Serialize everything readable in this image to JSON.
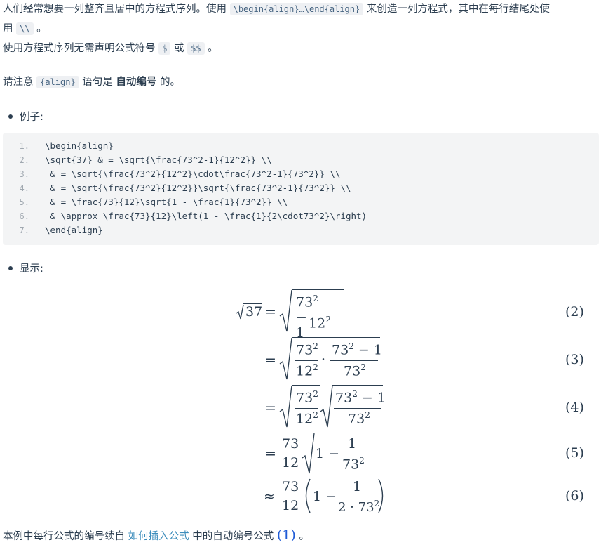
{
  "intro": {
    "p1_a": "人们经常想要一列整齐且居中的方程式序列。使用",
    "p1_code": "\\begin{align}…\\end{align}",
    "p1_b": "来创造一列方程式，其中在每行结尾处使",
    "p1_c": "用",
    "p1_code2": "\\\\",
    "p1_d": "。",
    "p2_a": "使用方程式序列无需声明公式符号",
    "p2_code1": "$",
    "p2_b": "或",
    "p2_code2": "$$",
    "p2_c": "。",
    "p3_a": "请注意",
    "p3_code": "{align}",
    "p3_b": "语句是",
    "p3_strong": "自动编号",
    "p3_c": "的。"
  },
  "example_label": "例子:",
  "code_lines": [
    {
      "n": "1.",
      "t": "\\begin{align}"
    },
    {
      "n": "2.",
      "t": "\\sqrt{37} & = \\sqrt{\\frac{73^2-1}{12^2}} \\\\"
    },
    {
      "n": "3.",
      "t": " & = \\sqrt{\\frac{73^2}{12^2}\\cdot\\frac{73^2-1}{73^2}} \\\\"
    },
    {
      "n": "4.",
      "t": " & = \\sqrt{\\frac{73^2}{12^2}}\\sqrt{\\frac{73^2-1}{73^2}} \\\\"
    },
    {
      "n": "5.",
      "t": " & = \\frac{73}{12}\\sqrt{1 - \\frac{1}{73^2}} \\\\"
    },
    {
      "n": "6.",
      "t": " & \\approx \\frac{73}{12}\\left(1 - \\frac{1}{2\\cdot73^2}\\right)"
    },
    {
      "n": "7.",
      "t": "\\end{align}"
    }
  ],
  "display_label": "显示:",
  "equation_tags": [
    "(2)",
    "(3)",
    "(4)",
    "(5)",
    "(6)"
  ],
  "math": {
    "sqrt37": "37",
    "eq": "=",
    "approx": "≈",
    "n73": "73",
    "n12": "12",
    "n1": "1",
    "sup2": "2",
    "minus1": "− 1",
    "one_minus": "1 −",
    "two_dot": "2 ·",
    "cdot": "·"
  },
  "footer": {
    "a": "本例中每行公式的编号续自",
    "link": "如何插入公式",
    "b": "中的自动编号公式",
    "ref": "(1)",
    "c": "。"
  }
}
